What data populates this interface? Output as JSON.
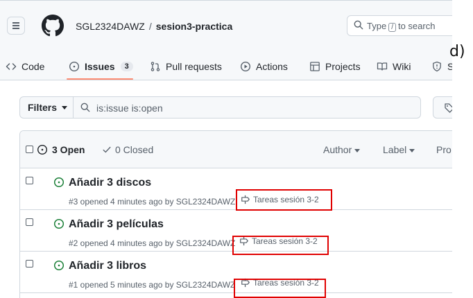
{
  "header": {
    "owner": "SGL2324DAWZ",
    "separator": "/",
    "repo": "sesion3-practica",
    "search_prefix": "Type",
    "search_key": "/",
    "search_suffix": "to search"
  },
  "tabs": [
    {
      "label": "Code",
      "icon": "code-icon"
    },
    {
      "label": "Issues",
      "icon": "issue-opened-icon",
      "count": "3",
      "selected": true
    },
    {
      "label": "Pull requests",
      "icon": "git-pull-request-icon"
    },
    {
      "label": "Actions",
      "icon": "play-icon"
    },
    {
      "label": "Projects",
      "icon": "table-icon"
    },
    {
      "label": "Wiki",
      "icon": "book-icon"
    },
    {
      "label": "S",
      "icon": "shield-icon"
    }
  ],
  "filters": {
    "button_label": "Filters",
    "query": "is:issue is:open"
  },
  "list_header": {
    "open_label": "3 Open",
    "closed_label": "0 Closed",
    "author_label": "Author",
    "label_label": "Label",
    "projects_label": "Pro"
  },
  "issues": [
    {
      "title": "Añadir 3 discos",
      "meta": "#3 opened 4 minutes ago by SGL2324DAWZ",
      "milestone": "Tareas sesión 3-2"
    },
    {
      "title": "Añadir 3 películas",
      "meta": "#2 opened 4 minutes ago by SGL2324DAWZ",
      "milestone": "Tareas sesión 3-2"
    },
    {
      "title": "Añadir 3 libros",
      "meta": "#1 opened 5 minutes ago by SGL2324DAWZ",
      "milestone": "Tareas sesión 3-2"
    }
  ],
  "annotation": "d)",
  "colors": {
    "open_green": "#1a7f37",
    "tab_underline": "#fd8c73",
    "highlight_red": "#e00000",
    "border": "#d0d7de"
  }
}
